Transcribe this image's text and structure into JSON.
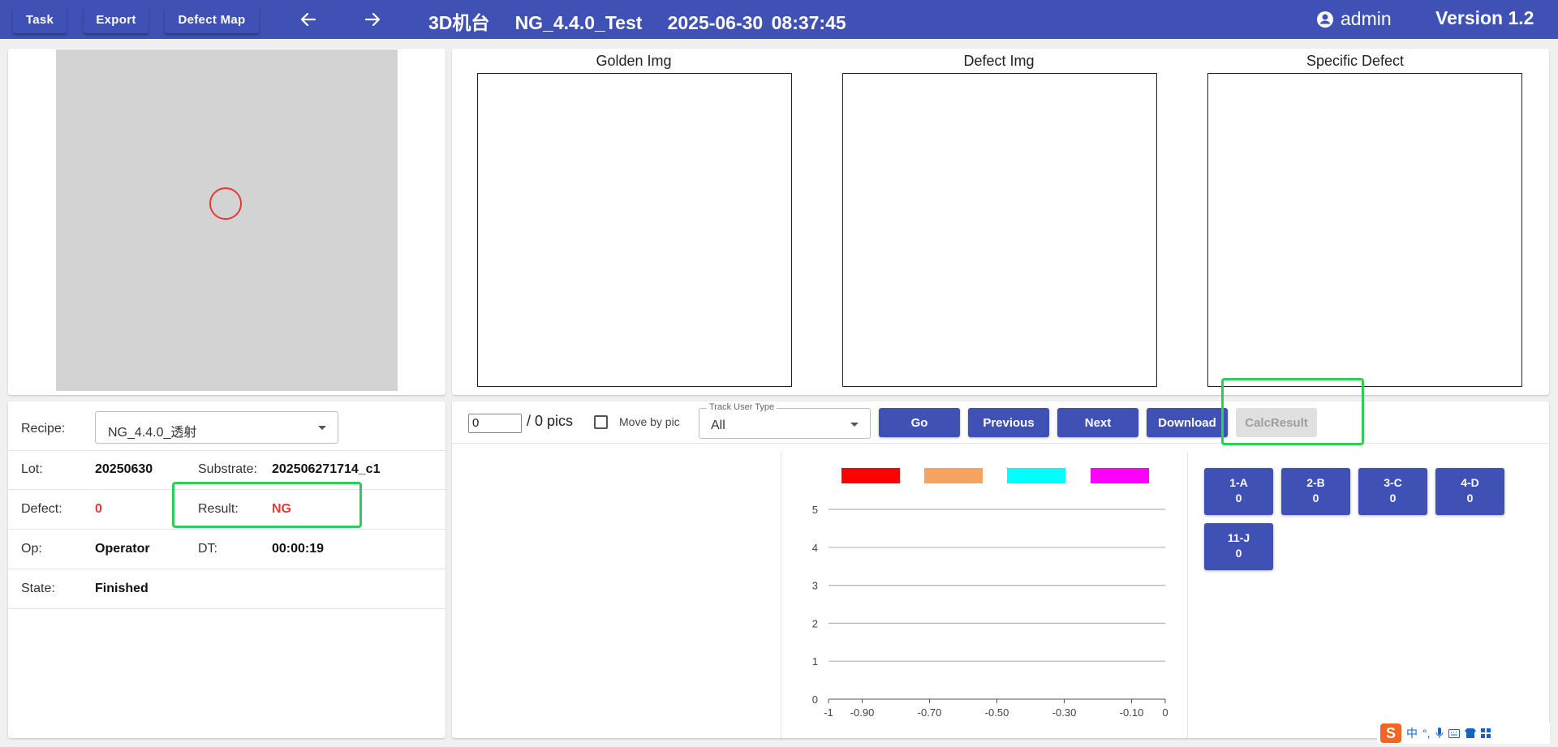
{
  "header": {
    "task_label": "Task",
    "export_label": "Export",
    "defect_map_label": "Defect Map",
    "title": "3D机台   NG_4.4.0_Test   2025-06-30 08:37:45",
    "user": "admin",
    "version": "Version 1.2"
  },
  "images": {
    "golden": "Golden Img",
    "defect": "Defect Img",
    "specific": "Specific Defect"
  },
  "info": {
    "recipe_label": "Recipe:",
    "recipe_value": "NG_4.4.0_透射",
    "lot_label": "Lot:",
    "lot_value": "20250630",
    "substrate_label": "Substrate:",
    "substrate_value": "202506271714_c1",
    "defect_label": "Defect:",
    "defect_value": "0",
    "result_label": "Result:",
    "result_value": "NG",
    "op_label": "Op:",
    "op_value": "Operator",
    "dt_label": "DT:",
    "dt_value": "00:00:19",
    "state_label": "State:",
    "state_value": "Finished"
  },
  "controls": {
    "page_value": "0",
    "pics_text": "/ 0 pics",
    "move_by_pic_label": "Move by pic",
    "track_legend": "Track User Type",
    "track_value": "All",
    "go_label": "Go",
    "previous_label": "Previous",
    "next_label": "Next",
    "download_label": "Download",
    "calc_label": "CalcResult"
  },
  "chart_data": {
    "type": "bar",
    "series": [
      {
        "color": "#ff0000",
        "values": []
      },
      {
        "color": "#f4a460",
        "values": []
      },
      {
        "color": "#00ffff",
        "values": []
      },
      {
        "color": "#ff00ff",
        "values": []
      }
    ],
    "xlim": [
      -1,
      0
    ],
    "ylim": [
      0,
      5
    ],
    "x_ticks": [
      "-1",
      "-0.90",
      "-0.70",
      "-0.50",
      "-0.30",
      "-0.10",
      "0"
    ],
    "y_ticks": [
      "0",
      "1",
      "2",
      "3",
      "4",
      "5"
    ],
    "grid": true
  },
  "categories": [
    {
      "label": "1-A",
      "count": "0"
    },
    {
      "label": "2-B",
      "count": "0"
    },
    {
      "label": "3-C",
      "count": "0"
    },
    {
      "label": "4-D",
      "count": "0"
    },
    {
      "label": "11-J",
      "count": "0"
    }
  ],
  "ime": {
    "logo": "S",
    "lang": "中"
  },
  "colors": {
    "primary": "#3f51b5",
    "ng_red": "#e53935",
    "highlight_green": "#2ecc58"
  }
}
